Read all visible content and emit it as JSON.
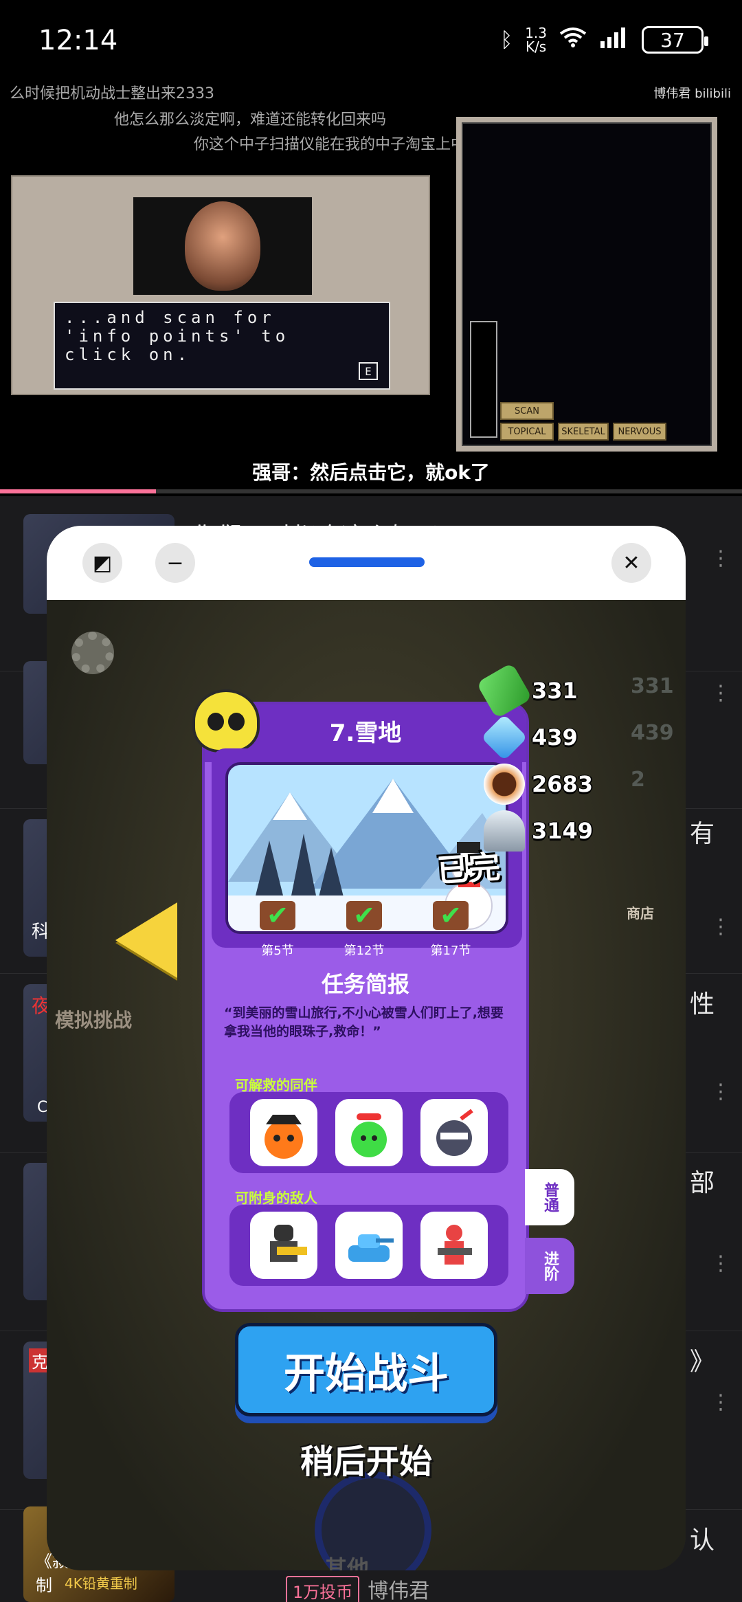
{
  "status_bar": {
    "time": "12:14",
    "net_speed_top": "1.3",
    "net_speed_unit": "K/s",
    "battery": "37"
  },
  "video": {
    "watermark": "博伟君 bilibili",
    "danmaku": [
      "么时候把机动战士整出来2333",
      "他怎么那么淡定啊，难道还能转化回来吗",
      "你这个中子扫描仪能在我的中子淘宝上中子包邮吗，支持中子淘金币吗"
    ],
    "screen_text": "...and scan for\n'info points' to\nclick on.",
    "screen_key": "E",
    "scanner_buttons": [
      "SCAN",
      "TOPICAL",
      "SKELETAL",
      "NERVOUS"
    ],
    "subtitle": "强哥：然后点击它，就ok了",
    "progress": 0.21
  },
  "list": {
    "row1_title": "你们平时都吃这么好吗？！",
    "row2_side": "有",
    "row3_side": "性",
    "row4_side": "部",
    "row5_side": "》",
    "row6_side": "认",
    "bottom_thumb_text": "《寂静岭》官宣重制",
    "bottom_thumb_sub": "4K铅黄重制",
    "bottom_badge": "1万投币",
    "bottom_author": "博伟君",
    "thumb_labels": [
      "科",
      "夜",
      "C",
      "克"
    ]
  },
  "floating_window": {
    "buttons": {
      "resize_icon": "◩",
      "minimize_icon": "−",
      "close_icon": "✕"
    },
    "accent": "#1e62e5"
  },
  "game": {
    "stage_title": "7.雪地",
    "checkpoints": [
      "第5节",
      "第12节",
      "第17节"
    ],
    "brief_title": "任务简报",
    "brief_text": "“到美丽的雪山旅行,不小心被雪人们盯上了,想要拿我当他的眼珠子,救命！”",
    "allies_label": "可解救的同伴",
    "enemies_label": "可附身的敌人",
    "tabs": [
      "普通",
      "进阶"
    ],
    "resources": [
      {
        "name": "cash",
        "value": "331"
      },
      {
        "name": "crystal",
        "value": "439"
      },
      {
        "name": "coffee",
        "value": "2683"
      },
      {
        "name": "screw",
        "value": "3149"
      }
    ],
    "resource_ghosts": [
      "331",
      "439",
      "2"
    ],
    "done_stamp": "已完",
    "sim_challenge": "模拟挑战",
    "shop": "商店",
    "start_button": "开始战斗",
    "later_button": "稍后开始",
    "other": "其他"
  }
}
